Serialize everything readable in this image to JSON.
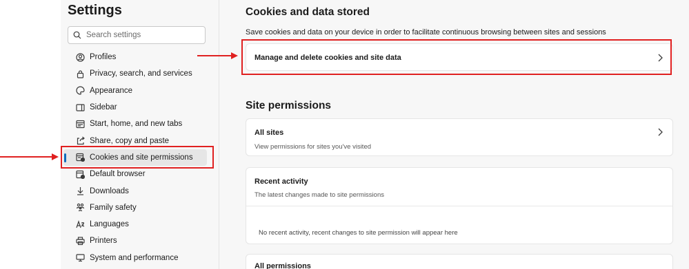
{
  "sidebar": {
    "title": "Settings",
    "search_placeholder": "Search settings",
    "items": [
      {
        "label": "Profiles",
        "icon": "profile-icon"
      },
      {
        "label": "Privacy, search, and services",
        "icon": "lock-icon"
      },
      {
        "label": "Appearance",
        "icon": "appearance-icon"
      },
      {
        "label": "Sidebar",
        "icon": "sidebar-icon"
      },
      {
        "label": "Start, home, and new tabs",
        "icon": "home-tabs-icon"
      },
      {
        "label": "Share, copy and paste",
        "icon": "share-icon"
      },
      {
        "label": "Cookies and site permissions",
        "icon": "cookies-icon",
        "active": true
      },
      {
        "label": "Default browser",
        "icon": "browser-icon"
      },
      {
        "label": "Downloads",
        "icon": "download-icon"
      },
      {
        "label": "Family safety",
        "icon": "family-icon"
      },
      {
        "label": "Languages",
        "icon": "languages-icon"
      },
      {
        "label": "Printers",
        "icon": "printer-icon"
      },
      {
        "label": "System and performance",
        "icon": "system-icon"
      }
    ]
  },
  "main": {
    "cookies_section": {
      "title": "Cookies and data stored",
      "description": "Save cookies and data on your device in order to facilitate continuous browsing between sites and sessions",
      "manage_label": "Manage and delete cookies and site data"
    },
    "permissions_section": {
      "title": "Site permissions",
      "all_sites": {
        "title": "All sites",
        "subtitle": "View permissions for sites you've visited"
      },
      "recent_activity": {
        "title": "Recent activity",
        "subtitle": "The latest changes made to site permissions",
        "empty": "No recent activity, recent changes to site permission will appear here"
      },
      "all_permissions": {
        "title": "All permissions"
      }
    }
  },
  "colors": {
    "accent": "#0f6cbd",
    "annotation": "#e02020"
  }
}
